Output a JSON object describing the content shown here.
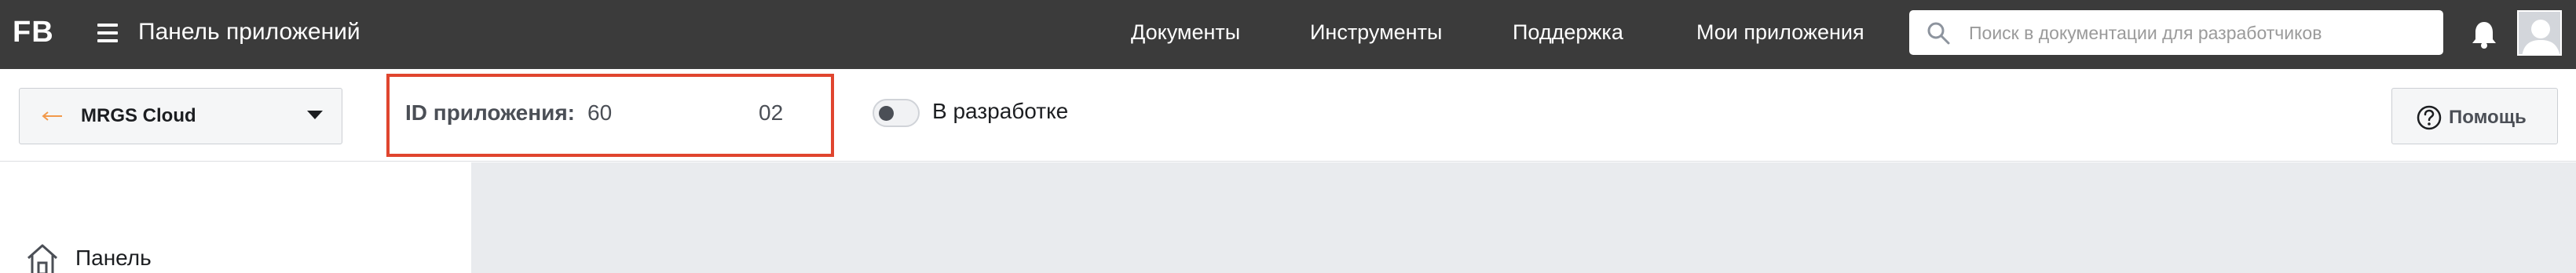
{
  "header": {
    "logo": "FB",
    "title": "Панель приложений",
    "nav": [
      {
        "label": "Документы"
      },
      {
        "label": "Инструменты"
      },
      {
        "label": "Поддержка"
      },
      {
        "label": "Мои приложения"
      }
    ],
    "search": {
      "placeholder": "Поиск в документации для разработчиков"
    },
    "icons": {
      "menu": "hamburger-menu-icon",
      "search": "search-icon",
      "notifications": "bell-icon",
      "profile": "avatar-placeholder"
    }
  },
  "subbar": {
    "app_selector": {
      "value": "MRGS Cloud"
    },
    "app_id": {
      "label": "ID приложения:",
      "part_start": "60",
      "part_end": "02"
    },
    "dev_mode": {
      "label": "В разработке",
      "on": false
    },
    "help_label": "Помощь"
  },
  "sidebar": {
    "items": [
      {
        "label": "Панель",
        "icon": "home-icon"
      }
    ]
  },
  "colors": {
    "topbar": "#3b3b3b",
    "highlight": "#e0452e",
    "content_bg": "#e9ebee"
  }
}
